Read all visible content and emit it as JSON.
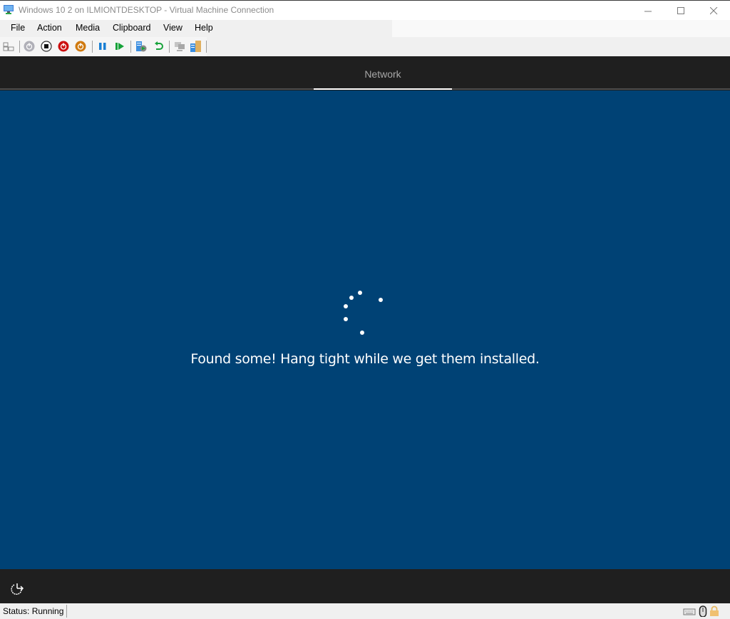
{
  "window": {
    "title": "Windows 10 2 on ILMIONTDESKTOP - Virtual Machine Connection",
    "controls": [
      "minimize",
      "maximize",
      "close"
    ]
  },
  "menu": {
    "items": [
      "File",
      "Action",
      "Media",
      "Clipboard",
      "View",
      "Help"
    ]
  },
  "toolbar": {
    "buttons": [
      {
        "name": "ctrl-alt-del",
        "icon": "ctrl-alt-del-icon",
        "enabled": true
      },
      {
        "name": "start",
        "icon": "power-icon",
        "enabled": false
      },
      {
        "name": "turn-off",
        "icon": "stop-icon",
        "enabled": true
      },
      {
        "name": "shut-down",
        "icon": "shutdown-icon",
        "enabled": true,
        "color": "#cc1010"
      },
      {
        "name": "save",
        "icon": "save-state-icon",
        "enabled": true,
        "color": "#d07a10"
      },
      {
        "name": "pause",
        "icon": "pause-icon",
        "enabled": true,
        "color": "#1a7fd4"
      },
      {
        "name": "reset",
        "icon": "reset-icon",
        "enabled": true,
        "color": "#17a33a"
      },
      {
        "name": "checkpoint",
        "icon": "checkpoint-icon",
        "enabled": true
      },
      {
        "name": "revert",
        "icon": "revert-icon",
        "enabled": true,
        "color": "#17a33a"
      },
      {
        "name": "enhanced-session",
        "icon": "enhanced-session-icon",
        "enabled": false
      },
      {
        "name": "share",
        "icon": "share-icon",
        "enabled": true
      }
    ]
  },
  "oobe": {
    "header_tab": "Network",
    "message": "Found some! Hang tight while we get them installed.",
    "background_color": "#004275",
    "footer_icon": "ease-of-access-icon"
  },
  "status": {
    "text": "Status: Running",
    "icons": [
      "keyboard-icon",
      "mouse-icon",
      "lock-icon"
    ]
  }
}
